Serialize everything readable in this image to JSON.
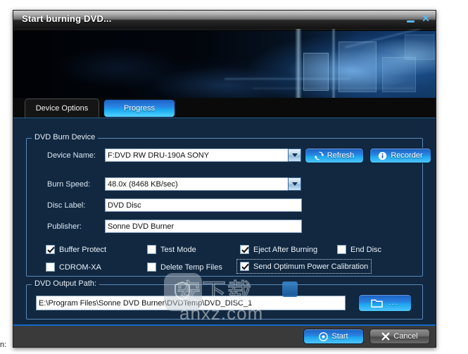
{
  "window": {
    "title": "Start burning DVD...",
    "minimize_label": "−",
    "close_label": "✕"
  },
  "tabs": [
    {
      "label": "Device Options",
      "active": true
    },
    {
      "label": "Progress",
      "active": false
    }
  ],
  "device_group": {
    "legend": "DVD Burn Device",
    "fields": {
      "device_name_label": "Device Name:",
      "device_name_value": "F:DVD RW DRU-190A SONY",
      "burn_speed_label": "Burn Speed:",
      "burn_speed_value": "48.0x (8468 KB/sec)",
      "disc_label_label": "Disc Label:",
      "disc_label_value": "DVD Disc",
      "publisher_label": "Publisher:",
      "publisher_value": "Sonne DVD Burner"
    },
    "buttons": {
      "refresh_label": "Refresh",
      "refresh_icon": "refresh-icon",
      "recorder_label": "Recorder",
      "recorder_icon": "info-icon"
    },
    "checkboxes": [
      {
        "label": "Buffer Protect",
        "checked": true
      },
      {
        "label": "Test Mode",
        "checked": false
      },
      {
        "label": "Eject After Burning",
        "checked": true
      },
      {
        "label": "End Disc",
        "checked": false
      },
      {
        "label": "CDROM-XA",
        "checked": false
      },
      {
        "label": "Delete Temp Files",
        "checked": false
      },
      {
        "label": "Send Optimum Power Calibration",
        "checked": true
      }
    ]
  },
  "output_group": {
    "legend": "DVD Output Path:",
    "path_value": "E:\\Program Files\\Sonne DVD Burner\\DVDTemp\\DVD_DISC_1",
    "browse_label": "...",
    "browse_icon": "folder-icon"
  },
  "footer": {
    "start_label": "Start",
    "start_icon": "disc-icon",
    "cancel_label": "Cancel",
    "cancel_icon": "x-icon"
  },
  "watermark": {
    "site": "anxz.com",
    "cjk": "安下载"
  },
  "edge_caption": "n:",
  "colors": {
    "panel_bg": "#112840",
    "group_border": "#5b89b8",
    "accent_blue": "#2a84e4",
    "title_accent": "#58b8ea",
    "bottom_bar": "#3a3a3a"
  }
}
